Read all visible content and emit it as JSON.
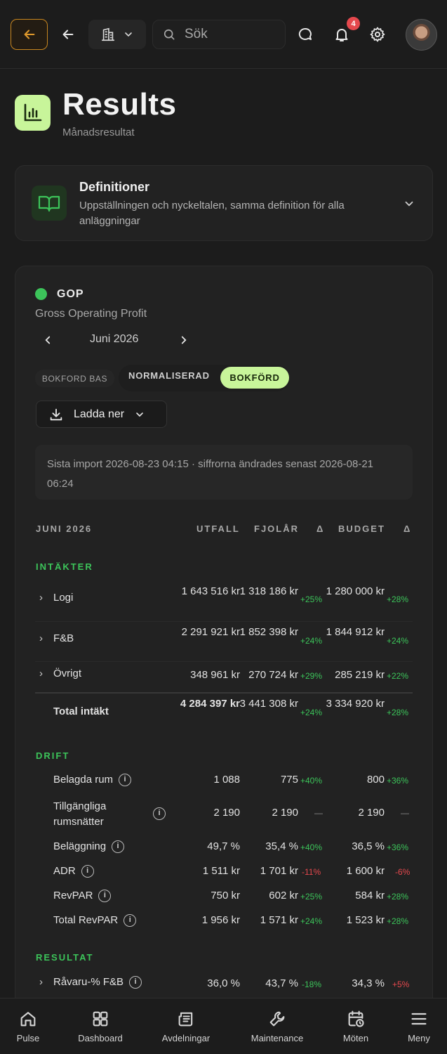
{
  "header": {
    "search_placeholder": "Sök",
    "notification_count": "4"
  },
  "page": {
    "title": "Results",
    "subtitle": "Månadsresultat"
  },
  "definitions": {
    "title": "Definitioner",
    "text": "Uppställningen och nyckeltalen, samma definition för alla anläggningar"
  },
  "report": {
    "badge": "GOP",
    "subtitle": "Gross Operating Profit",
    "month": "Juni 2026",
    "toggle_bas": "BOKFORD BAS",
    "toggle_norm": "NORMALISERAD",
    "toggle_bokford": "BOKFÖRD",
    "download_label": "Ladda ner",
    "import_note": "Sista import 2026-08-23 04:15 · siffrorna ändrades senast 2026-08-21 06:24",
    "columns": {
      "period": "JUNI 2026",
      "utfall": "UTFALL",
      "fjolar": "FJOLÅR",
      "delta1": "Δ",
      "budget": "BUDGET",
      "delta2": "Δ"
    }
  },
  "sections": {
    "intakter": "INTÄKTER",
    "drift": "DRIFT",
    "resultat": "RESULTAT"
  },
  "intakter_rows": [
    {
      "label": "Logi",
      "utfall": "1 643 516 kr",
      "fjolar": "1 318 186 kr",
      "d1": "+25%",
      "budget": "1 280 000 kr",
      "d2": "+28%"
    },
    {
      "label": "F&B",
      "utfall": "2 291 921 kr",
      "fjolar": "1 852 398 kr",
      "d1": "+24%",
      "budget": "1 844 912 kr",
      "d2": "+24%"
    },
    {
      "label": "Övrigt",
      "utfall": "348 961 kr",
      "fjolar": "270 724 kr",
      "d1": "+29%",
      "budget": "285 219 kr",
      "d2": "+22%"
    }
  ],
  "total_intakt": {
    "label": "Total intäkt",
    "utfall": "4 284 397 kr",
    "fjolar": "3 441 308 kr",
    "d1": "+24%",
    "budget": "3 334 920 kr",
    "d2": "+28%"
  },
  "drift_rows": [
    {
      "label": "Belagda rum",
      "utfall": "1 088",
      "fjolar": "775",
      "d1": "+40%",
      "budget": "800",
      "d2": "+36%"
    },
    {
      "label": "Tillgängliga rumsnätter",
      "utfall": "2 190",
      "fjolar": "2 190",
      "d1": "—",
      "budget": "2 190",
      "d2": "—"
    },
    {
      "label": "Beläggning",
      "utfall": "49,7 %",
      "fjolar": "35,4 %",
      "d1": "+40%",
      "budget": "36,5 %",
      "d2": "+36%"
    },
    {
      "label": "ADR",
      "utfall": "1 511 kr",
      "fjolar": "1 701 kr",
      "d1": "-11%",
      "budget": "1 600 kr",
      "d2": "-6%"
    },
    {
      "label": "RevPAR",
      "utfall": "750 kr",
      "fjolar": "602 kr",
      "d1": "+25%",
      "budget": "584 kr",
      "d2": "+28%"
    },
    {
      "label": "Total RevPAR",
      "utfall": "1 956 kr",
      "fjolar": "1 571 kr",
      "d1": "+24%",
      "budget": "1 523 kr",
      "d2": "+28%"
    }
  ],
  "resultat_rows": [
    {
      "label": "Råvaru-% F&B",
      "utfall": "36,0 %",
      "fjolar": "43,7 %",
      "d1": "-18%",
      "budget": "34,3 %",
      "d2": "+5%"
    }
  ],
  "info_glyph": "i",
  "nav": {
    "pulse": "Pulse",
    "dashboard": "Dashboard",
    "avdelningar": "Avdelningar",
    "maintenance": "Maintenance",
    "moten": "Möten",
    "meny": "Meny"
  },
  "colors": {
    "accent": "#c8f59a",
    "positive": "#3cc45a",
    "negative": "#e5484d",
    "warning_border": "#c8861f"
  }
}
